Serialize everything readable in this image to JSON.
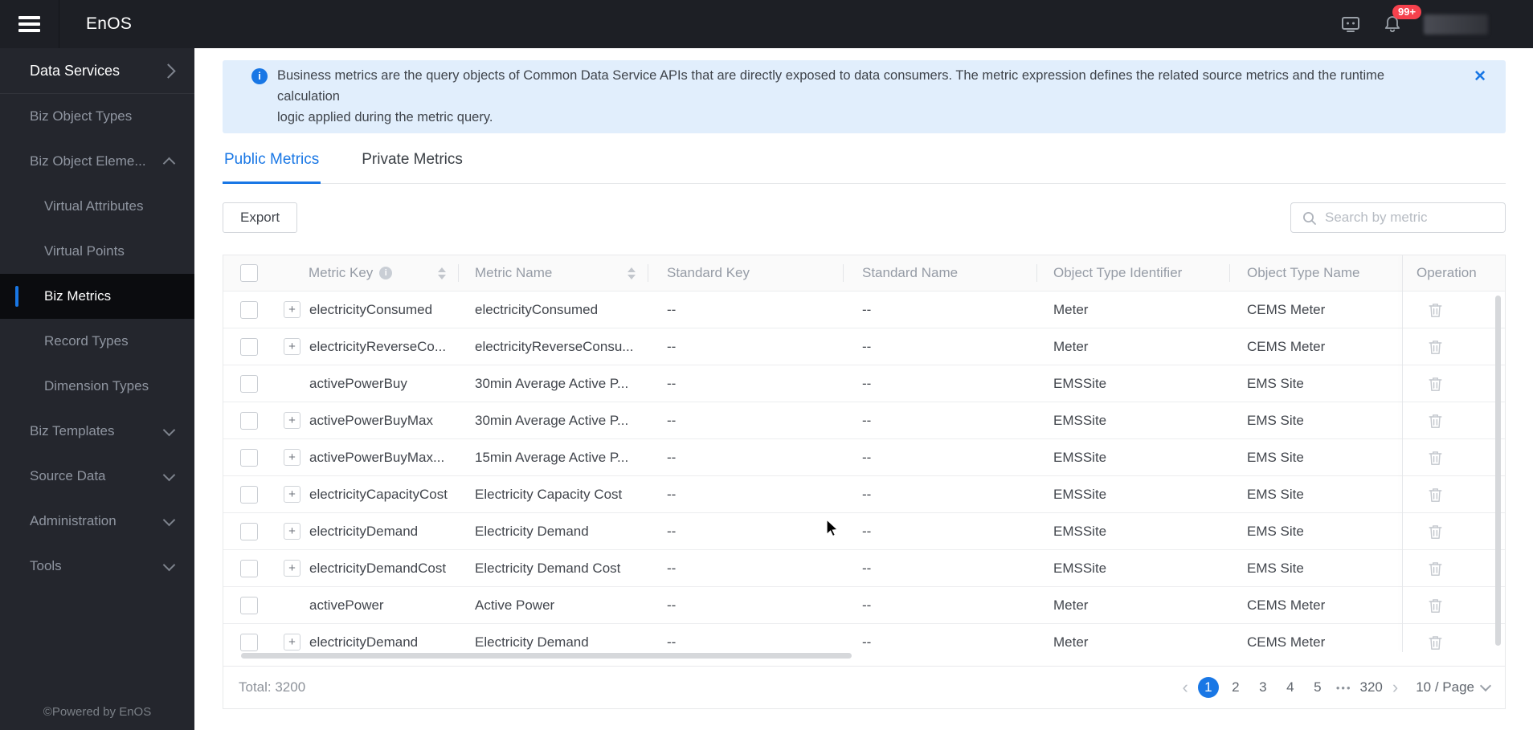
{
  "topbar": {
    "brand": "EnOS",
    "notification_badge": "99+"
  },
  "sidebar": {
    "section": {
      "label": "Data Services"
    },
    "items": [
      {
        "label": "Biz Object Types",
        "level": 1,
        "chevron": null,
        "active": false
      },
      {
        "label": "Biz Object Eleme...",
        "level": 1,
        "chevron": "up",
        "active": false
      },
      {
        "label": "Virtual Attributes",
        "level": 2,
        "chevron": null,
        "active": false
      },
      {
        "label": "Virtual Points",
        "level": 2,
        "chevron": null,
        "active": false
      },
      {
        "label": "Biz Metrics",
        "level": 2,
        "chevron": null,
        "active": true
      },
      {
        "label": "Record Types",
        "level": 2,
        "chevron": null,
        "active": false
      },
      {
        "label": "Dimension Types",
        "level": 2,
        "chevron": null,
        "active": false
      },
      {
        "label": "Biz Templates",
        "level": 1,
        "chevron": "down",
        "active": false
      },
      {
        "label": "Source Data",
        "level": 1,
        "chevron": "down",
        "active": false
      },
      {
        "label": "Administration",
        "level": 1,
        "chevron": "down",
        "active": false
      },
      {
        "label": "Tools",
        "level": 1,
        "chevron": "down",
        "active": false
      }
    ],
    "footer": "©Powered by EnOS"
  },
  "banner": {
    "lines": [
      "Business metrics are the query objects of Common Data Service APIs that are directly exposed to data consumers. The metric expression defines the related source metrics and the runtime calculation",
      "logic applied during the metric query."
    ]
  },
  "tabs": [
    {
      "label": "Public Metrics",
      "active": true
    },
    {
      "label": "Private Metrics",
      "active": false
    }
  ],
  "toolbar": {
    "export_label": "Export",
    "search_placeholder": "Search by metric"
  },
  "table": {
    "columns": [
      {
        "label": "Metric Key",
        "info": true,
        "sortable": true
      },
      {
        "label": "Metric Name",
        "info": false,
        "sortable": true
      },
      {
        "label": "Standard Key",
        "info": false,
        "sortable": false
      },
      {
        "label": "Standard Name",
        "info": false,
        "sortable": false
      },
      {
        "label": "Object Type Identifier",
        "info": false,
        "sortable": false
      },
      {
        "label": "Object Type Name",
        "info": false,
        "sortable": false
      },
      {
        "label": "Operation",
        "info": false,
        "sortable": false
      }
    ],
    "rows": [
      {
        "expandable": true,
        "metric_key": "electricityConsumed",
        "metric_name": "electricityConsumed",
        "standard_key": "--",
        "standard_name": "--",
        "object_type_identifier": "Meter",
        "object_type_name": "CEMS Meter"
      },
      {
        "expandable": true,
        "metric_key": "electricityReverseCo...",
        "metric_name": "electricityReverseConsu...",
        "standard_key": "--",
        "standard_name": "--",
        "object_type_identifier": "Meter",
        "object_type_name": "CEMS Meter"
      },
      {
        "expandable": false,
        "metric_key": "activePowerBuy",
        "metric_name": "30min Average Active P...",
        "standard_key": "--",
        "standard_name": "--",
        "object_type_identifier": "EMSSite",
        "object_type_name": "EMS Site"
      },
      {
        "expandable": true,
        "metric_key": "activePowerBuyMax",
        "metric_name": "30min Average Active P...",
        "standard_key": "--",
        "standard_name": "--",
        "object_type_identifier": "EMSSite",
        "object_type_name": "EMS Site"
      },
      {
        "expandable": true,
        "metric_key": "activePowerBuyMax...",
        "metric_name": "15min Average Active P...",
        "standard_key": "--",
        "standard_name": "--",
        "object_type_identifier": "EMSSite",
        "object_type_name": "EMS Site"
      },
      {
        "expandable": true,
        "metric_key": "electricityCapacityCost",
        "metric_name": "Electricity Capacity Cost",
        "standard_key": "--",
        "standard_name": "--",
        "object_type_identifier": "EMSSite",
        "object_type_name": "EMS Site"
      },
      {
        "expandable": true,
        "metric_key": "electricityDemand",
        "metric_name": "Electricity Demand",
        "standard_key": "--",
        "standard_name": "--",
        "object_type_identifier": "EMSSite",
        "object_type_name": "EMS Site"
      },
      {
        "expandable": true,
        "metric_key": "electricityDemandCost",
        "metric_name": "Electricity Demand Cost",
        "standard_key": "--",
        "standard_name": "--",
        "object_type_identifier": "EMSSite",
        "object_type_name": "EMS Site"
      },
      {
        "expandable": false,
        "metric_key": "activePower",
        "metric_name": "Active Power",
        "standard_key": "--",
        "standard_name": "--",
        "object_type_identifier": "Meter",
        "object_type_name": "CEMS Meter"
      },
      {
        "expandable": true,
        "metric_key": "electricityDemand",
        "metric_name": "Electricity Demand",
        "standard_key": "--",
        "standard_name": "--",
        "object_type_identifier": "Meter",
        "object_type_name": "CEMS Meter"
      }
    ]
  },
  "pagination": {
    "total": "Total: 3200",
    "pages": [
      "1",
      "2",
      "3",
      "4",
      "5"
    ],
    "current": "1",
    "ellipsis": "•••",
    "last_page": "320",
    "page_size": "10 / Page"
  },
  "colors": {
    "accent": "#1977e5",
    "banner_bg": "#e1eefc",
    "badge": "#f5414d",
    "topbar_bg": "#1d1f25",
    "sidebar_bg": "#24262d"
  }
}
